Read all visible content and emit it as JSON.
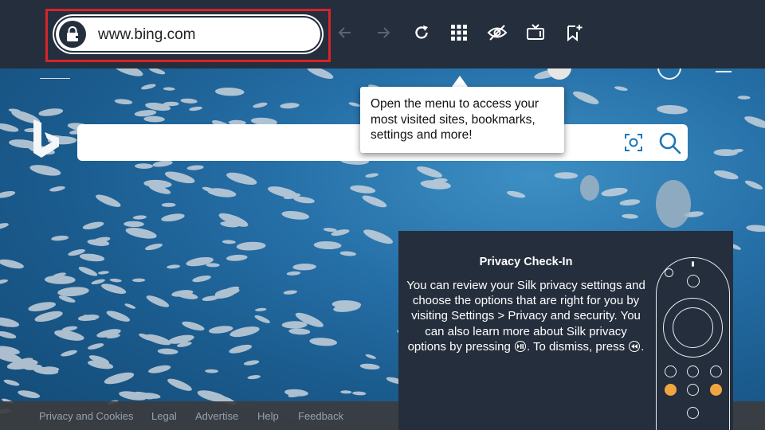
{
  "toolbar": {
    "url": "www.bing.com",
    "icons": [
      "lock-icon",
      "back-arrow-icon",
      "forward-arrow-icon",
      "reload-icon",
      "apps-grid-icon",
      "hide-eye-icon",
      "tv-mode-icon",
      "add-bookmark-icon"
    ]
  },
  "tooltip": {
    "text": "Open the menu to access your most visited sites, bookmarks, settings and more!"
  },
  "bing": {
    "logo": "bing-logo-icon",
    "search_placeholder": ""
  },
  "footer": {
    "links": [
      "Privacy and Cookies",
      "Legal",
      "Advertise",
      "Help",
      "Feedback"
    ]
  },
  "privacy": {
    "title": "Privacy Check-In",
    "body_part1": "You can review your Silk privacy settings and choose the options that are right for you by visiting Settings > Privacy and security. You can also learn more about Silk privacy options by pressing",
    "body_part2": ". To dismiss, press",
    "body_part3": "."
  },
  "colors": {
    "toolbar_bg": "#252e3c",
    "highlight": "#d8232a",
    "panel_bg": "#252e3c",
    "remote_accent": "#f0a640",
    "search_icon": "#1c76b8"
  }
}
